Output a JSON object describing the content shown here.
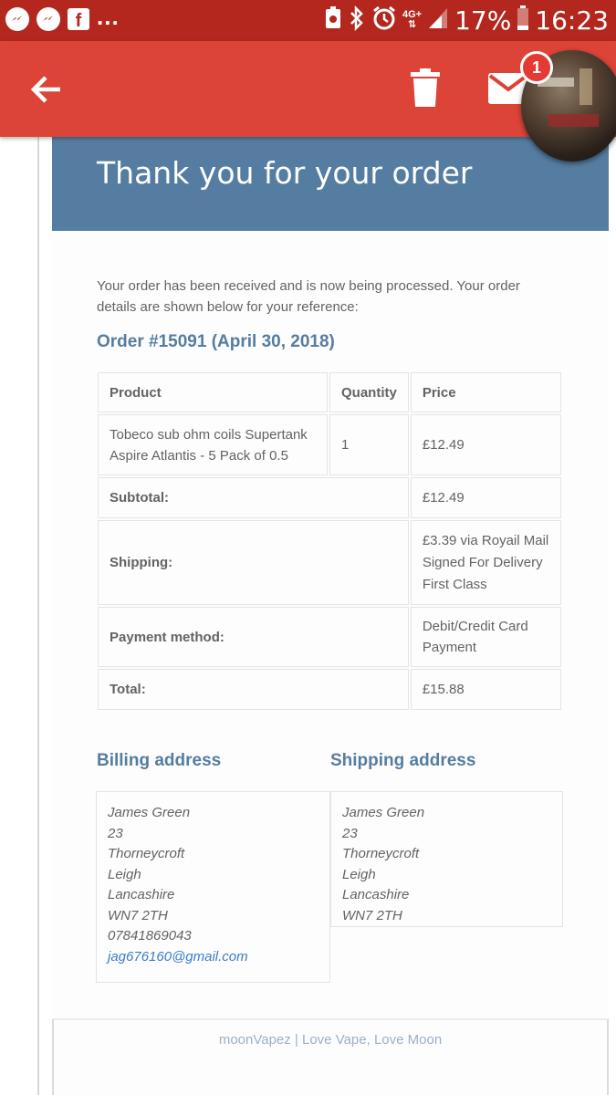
{
  "status_bar": {
    "icons_left": [
      "messenger-icon",
      "messenger-icon",
      "facebook-icon"
    ],
    "more": "...",
    "network": "4G+",
    "battery_percent": "17%",
    "time": "16:23"
  },
  "app_bar": {
    "badge_count": "1",
    "colors": {
      "status_bar": "#b3271f",
      "app_bar": "#dc4437"
    }
  },
  "email": {
    "header_title": "Thank you for your order",
    "intro": "Your order has been received and is now being processed. Your order details are shown below for your reference:",
    "order_title": "Order #15091 (April 30, 2018)",
    "table": {
      "headers": [
        "Product",
        "Quantity",
        "Price"
      ],
      "item": {
        "product": "Tobeco sub ohm coils Supertank Aspire Atlantis - 5 Pack of 0.5",
        "quantity": "1",
        "price": "£12.49"
      },
      "totals": [
        {
          "label": "Subtotal:",
          "value": "£12.49"
        },
        {
          "label": "Shipping:",
          "value": "£3.39 via Royail Mail Signed For Delivery First Class"
        },
        {
          "label": "Payment method:",
          "value": "Debit/Credit Card Payment"
        },
        {
          "label": "Total:",
          "value": "£15.88"
        }
      ]
    },
    "billing": {
      "title": "Billing address",
      "lines": [
        "James Green",
        "23",
        "Thorneycroft",
        "Leigh",
        "Lancashire",
        "WN7 2TH",
        "07841869043"
      ],
      "email": "jag676160@gmail.com"
    },
    "shipping": {
      "title": "Shipping address",
      "lines": [
        "James Green",
        "23",
        "Thorneycroft",
        "Leigh",
        "Lancashire",
        "WN7 2TH"
      ]
    },
    "footer": "moonVapez | Love Vape, Love Moon",
    "accent_color": "#557da1"
  }
}
